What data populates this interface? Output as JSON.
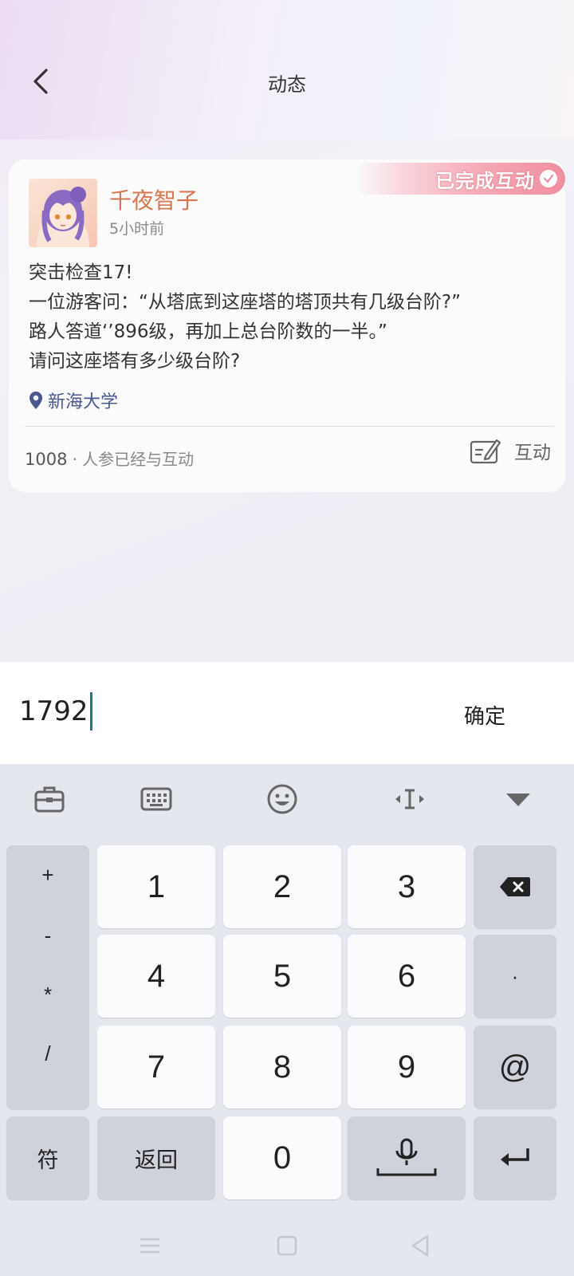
{
  "header": {
    "title": "动态",
    "back_icon": "chevron-left-icon"
  },
  "post": {
    "badge": "已完成互动",
    "author": "千夜智子",
    "time": "5小时前",
    "body_lines": [
      "突击检查17!",
      "一位游客问：“从塔底到这座塔的塔顶共有几级台阶?”",
      "路人答道‘’896级，再加上总台阶数的一半。”",
      "请问这座塔有多少级台阶?"
    ],
    "location": "新海大学",
    "count": "1008",
    "count_separator": "·",
    "count_label": "人参已经与互动",
    "interact_label": "互动"
  },
  "answer": {
    "value": "1792",
    "confirm_label": "确定"
  },
  "keyboard": {
    "toolbar_icons": [
      "toolbox-icon",
      "keyboard-icon",
      "emoji-icon",
      "cursor-move-icon",
      "collapse-down-icon"
    ],
    "symbols": [
      "+",
      "-",
      "*",
      "/"
    ],
    "keys": {
      "k1": "1",
      "k2": "2",
      "k3": "3",
      "k4": "4",
      "k5": "5",
      "k6": "6",
      "k7": "7",
      "k8": "8",
      "k9": "9",
      "k0": "0",
      "dot": "·",
      "at": "@",
      "fu": "符",
      "fanhui": "返回"
    }
  },
  "colors": {
    "author": "#d7774f",
    "location": "#4a5790",
    "caret": "#1a7f7a",
    "badge": "#f08ea0"
  }
}
